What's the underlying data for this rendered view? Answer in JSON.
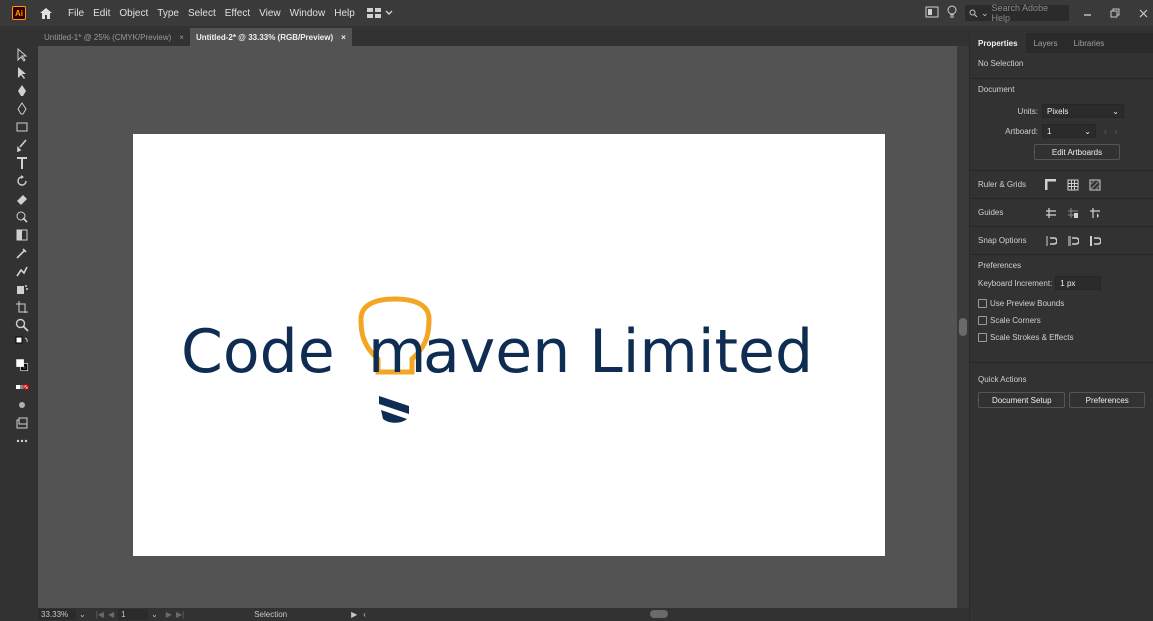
{
  "app": {
    "logo": "Ai"
  },
  "menu": [
    "File",
    "Edit",
    "Object",
    "Type",
    "Select",
    "Effect",
    "View",
    "Window",
    "Help"
  ],
  "search": {
    "placeholder": "Search Adobe Help"
  },
  "tabs": [
    {
      "label": "Untitled-1* @ 25% (CMYK/Preview)",
      "close": "×"
    },
    {
      "label": "Untitled-2* @ 33.33% (RGB/Preview)",
      "close": "×"
    }
  ],
  "logo_text": {
    "left": "Code",
    "m": "m",
    "right": "aven Limited",
    "primary": "#0f2c52",
    "accent": "#f2a623"
  },
  "status": {
    "zoom": "33.33%",
    "page": "1",
    "tool": "Selection"
  },
  "panel": {
    "tabs": [
      "Properties",
      "Layers",
      "Libraries"
    ],
    "no_selection": "No Selection",
    "document": "Document",
    "units_label": "Units:",
    "units_value": "Pixels",
    "artboard_label": "Artboard:",
    "artboard_value": "1",
    "edit_artboards": "Edit Artboards",
    "ruler_grids": "Ruler & Grids",
    "guides": "Guides",
    "snap_options": "Snap Options",
    "preferences_header": "Preferences",
    "keyboard_increment_label": "Keyboard Increment:",
    "keyboard_increment_value": "1 px",
    "use_preview_bounds": "Use Preview Bounds",
    "scale_corners": "Scale Corners",
    "scale_strokes": "Scale Strokes & Effects",
    "quick_actions": "Quick Actions",
    "document_setup": "Document Setup",
    "preferences_btn": "Preferences"
  }
}
